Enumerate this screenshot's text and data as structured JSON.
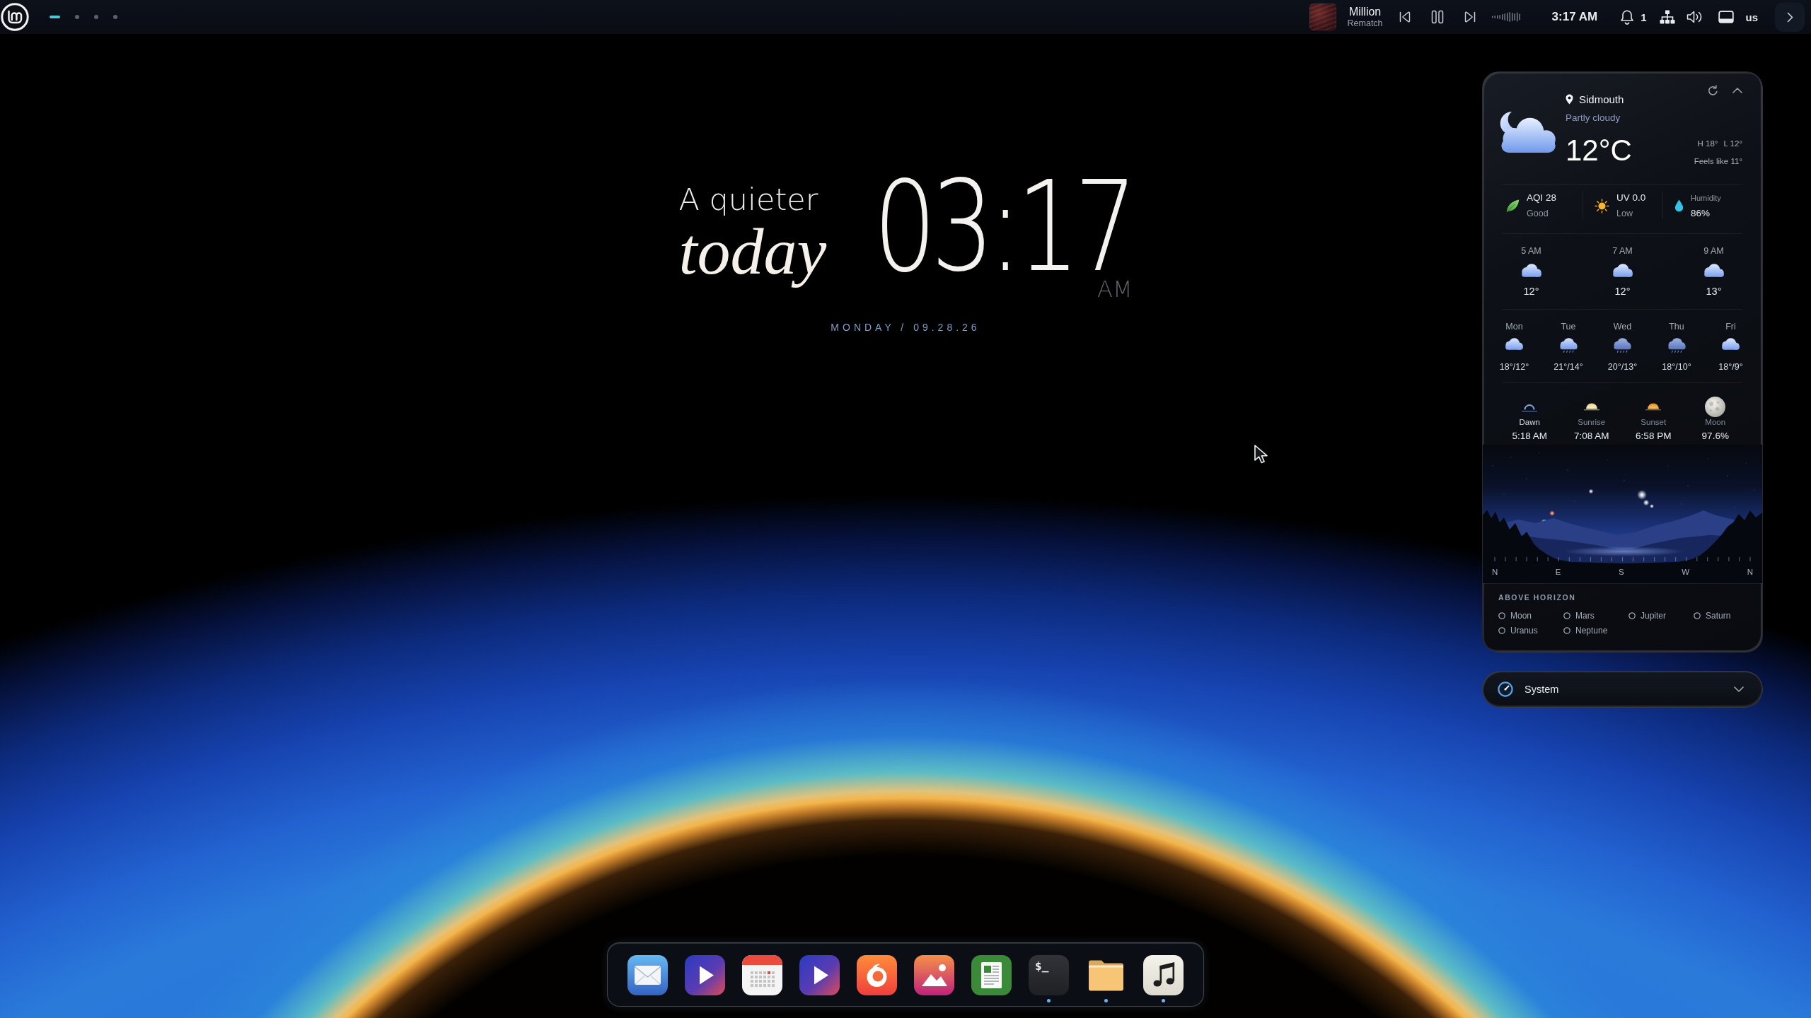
{
  "top_bar": {
    "workspaces": [
      {
        "selected": true
      },
      {
        "selected": false
      },
      {
        "selected": false
      },
      {
        "selected": false
      }
    ],
    "media": {
      "title": "Million",
      "artist": "Rematch",
      "playing": true
    },
    "clock": "3:17 AM",
    "notification_count": "1",
    "keyboard_layout": "us"
  },
  "desktop_clock": {
    "tagline": "A quieter",
    "tagline_emphasis": "today",
    "time": "03:17",
    "period": "AM",
    "date": "MONDAY / 09.28.26"
  },
  "weather": {
    "expanded": true,
    "location": "Sidmouth",
    "condition": "Partly cloudy",
    "temperature": "12°C",
    "high": "H 18°",
    "low": "L 12°",
    "feels_like": "Feels like 11°",
    "stats": [
      {
        "kind": "aqi",
        "title": "AQI 28",
        "subtitle": "Good"
      },
      {
        "kind": "uv",
        "title": "UV 0.0",
        "subtitle": "Low"
      },
      {
        "kind": "humidity",
        "title": "Humidity",
        "subtitle": "86%"
      }
    ],
    "hourly": [
      {
        "time": "5 AM",
        "kind": "cloud",
        "temp": "12°"
      },
      {
        "time": "7 AM",
        "kind": "cloud",
        "temp": "12°"
      },
      {
        "time": "9 AM",
        "kind": "cloud",
        "temp": "13°"
      }
    ],
    "daily": [
      {
        "day": "Mon",
        "kind": "cloud",
        "temps": "18°/12°"
      },
      {
        "day": "Tue",
        "kind": "drizzle",
        "temps": "21°/14°"
      },
      {
        "day": "Wed",
        "kind": "rain",
        "temps": "20°/13°"
      },
      {
        "day": "Thu",
        "kind": "rain",
        "temps": "18°/10°"
      },
      {
        "day": "Fri",
        "kind": "cloud",
        "temps": "18°/9°"
      }
    ],
    "sun_moon": [
      {
        "kind": "dawn",
        "label": "Dawn",
        "value": "5:18 AM",
        "active": true
      },
      {
        "kind": "sunrise",
        "label": "Sunrise",
        "value": "7:08 AM",
        "active": false
      },
      {
        "kind": "sunset",
        "label": "Sunset",
        "value": "6:58 PM",
        "active": false
      },
      {
        "kind": "moon",
        "label": "Moon",
        "value": "97.6%",
        "active": false
      }
    ],
    "compass": [
      "N",
      "E",
      "S",
      "W",
      "N"
    ],
    "above_horizon": {
      "title": "ABOVE HORIZON",
      "bodies": [
        {
          "name": "Moon",
          "selected": false
        },
        {
          "name": "Mars",
          "selected": false
        },
        {
          "name": "Jupiter",
          "selected": false
        },
        {
          "name": "Saturn",
          "selected": false
        },
        {
          "name": "Uranus",
          "selected": false
        },
        {
          "name": "Neptune",
          "selected": false
        }
      ]
    }
  },
  "system_panel": {
    "title": "System",
    "expanded": false
  },
  "dock": {
    "apps": [
      {
        "kind": "mail",
        "running": false
      },
      {
        "kind": "player",
        "running": false
      },
      {
        "kind": "calendar",
        "running": false
      },
      {
        "kind": "player",
        "running": false
      },
      {
        "kind": "browser",
        "running": false
      },
      {
        "kind": "photos",
        "running": false
      },
      {
        "kind": "document",
        "running": false
      },
      {
        "kind": "terminal",
        "glyph": "$_",
        "running": true
      },
      {
        "kind": "files",
        "running": true
      },
      {
        "kind": "music",
        "running": true
      }
    ]
  }
}
